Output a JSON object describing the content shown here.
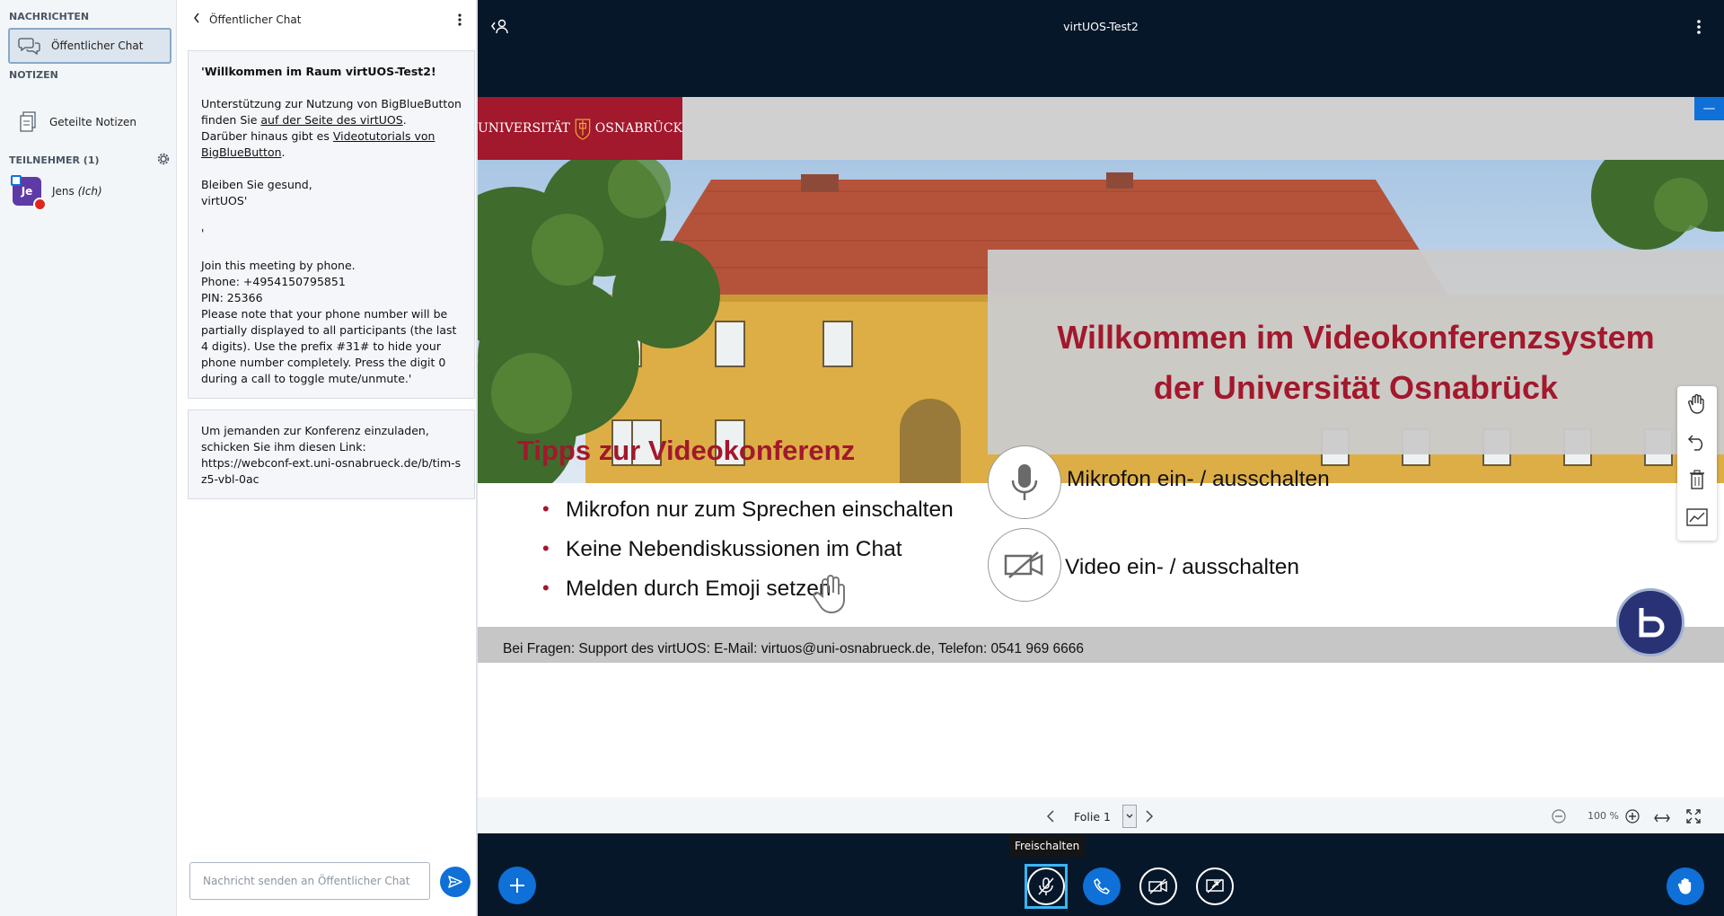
{
  "sidebar": {
    "messages_title": "NACHRICHTEN",
    "public_chat_label": "Öffentlicher Chat",
    "notes_title": "NOTIZEN",
    "shared_notes_label": "Geteilte Notizen",
    "participants_title": "TEILNEHMER (1)",
    "users": [
      {
        "initials": "Je",
        "name": "Jens",
        "suffix": "(Ich)"
      }
    ]
  },
  "chat": {
    "header_label": "Öffentlicher Chat",
    "welcome": {
      "line1_pre": "'Willkommen im Raum ",
      "line1_room": "virtUOS-Test2",
      "line1_post": "!",
      "support_pre": "Unterstützung zur Nutzung von BigBlueButton finden Sie ",
      "support_link": "auf der Seite des virtUOS",
      "support_post": ".",
      "tutorial_pre": "Darüber hinaus gibt es ",
      "tutorial_link": "Videotutorials von BigBlueButton",
      "tutorial_post": ".",
      "greeting1": "Bleiben Sie gesund,",
      "greeting2": "virtUOS'",
      "separator": "'",
      "phone_intro": "Join this meeting by phone.",
      "phone": "Phone: +4954150795851",
      "pin": "PIN: 25366",
      "phone_note": "Please note that your phone number will be partially displayed to all participants (the last 4 digits). Use the prefix #31# to hide your phone number completely. Press the digit 0 during a call to toggle mute/unmute.'"
    },
    "invite": {
      "text": "Um jemanden zur Konferenz einzuladen, schicken Sie ihm diesen Link:",
      "link": "https://webconf-ext.uni-osnabrueck.de/b/tim-sz5-vbl-0ac"
    },
    "input_placeholder": "Nachricht senden an Öffentlicher Chat"
  },
  "header": {
    "room_title": "virtUOS-Test2"
  },
  "slide": {
    "logo_text_left": "UNIVERSITÄT",
    "logo_text_right": "OSNABRÜCK",
    "headline_line1": "Willkommen im Videokonferenzsystem",
    "headline_line2": "der Universität Osnabrück",
    "tips_title": "Tipps zur Videokonferenz",
    "tips": [
      "Mikrofon nur zum Sprechen einschalten",
      "Keine Nebendiskussionen im Chat",
      "Melden durch Emoji setzen"
    ],
    "mic_label": "Mikrofon ein- / ausschalten",
    "video_label": "Video ein- / ausschalten",
    "footer": "Bei Fragen: Support des virtUOS: E-Mail: virtuos@uni-osnabrueck.de, Telefon: 0541 969 6666",
    "minimize_label": "—"
  },
  "presentation_bar": {
    "slide_label": "Folie 1",
    "zoom": "100 %"
  },
  "actions": {
    "tooltip": "Freischalten"
  },
  "colors": {
    "brand_red": "#a2182c",
    "primary_blue": "#0f70d7",
    "navy": "#06172a"
  }
}
